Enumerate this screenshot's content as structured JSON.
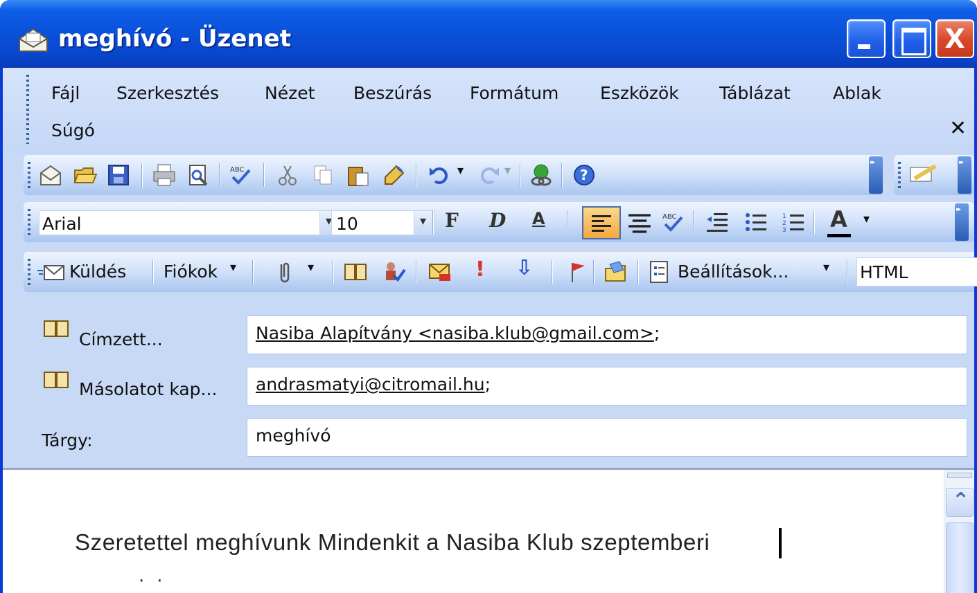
{
  "window": {
    "title": "meghívó - Üzenet",
    "close_glyph": "X"
  },
  "menu": {
    "items": [
      "Fájl",
      "Szerkesztés",
      "Nézet",
      "Beszúrás",
      "Formátum",
      "Eszközök",
      "Táblázat",
      "Ablak",
      "Súgó"
    ],
    "close_glyph": "✕"
  },
  "formatting": {
    "font": "Arial",
    "size": "10",
    "bold": "F",
    "italic": "D",
    "underline": "A",
    "font_color": "A"
  },
  "send_toolbar": {
    "send_label": "Küldés",
    "accounts_label": "Fiókok",
    "options_label": "Beállítások...",
    "format_label": "HTML"
  },
  "header": {
    "to_label": "Címzett...",
    "to_value": "Nasiba Alapítvány <nasiba.klub@gmail.com>",
    "cc_label": "Másolatot kap...",
    "cc_value": "andrasmatyi@citromail.hu",
    "subject_label": "Tárgy:",
    "subject_value": "meghívó",
    "separator": ";"
  },
  "body": {
    "text": "Szeretettel meghívunk Mindenkit a Nasiba Klub szeptemberi"
  },
  "colors": {
    "titlebar": "#0a4fd8",
    "client": "#c7d9f5",
    "active_button": "#f3a840"
  }
}
